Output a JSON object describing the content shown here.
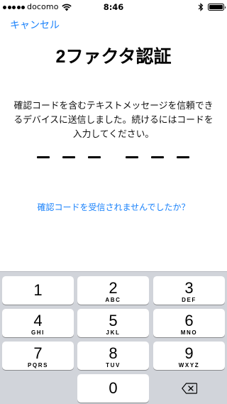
{
  "status_bar": {
    "carrier": "docomo",
    "time": "8:46",
    "icons": [
      "signal-dots-icon",
      "wifi-icon",
      "bluetooth-icon",
      "battery-icon"
    ]
  },
  "nav": {
    "cancel_label": "キャンセル"
  },
  "title": "2ファクタ認証",
  "description": "確認コードを含むテキストメッセージを信頼できるデバイスに送信しました。続けるにはコードを入力してください。",
  "code": {
    "length": 6,
    "filled": 0
  },
  "resend_link": "確認コードを受信されませんでしたか？",
  "keypad": {
    "k1": {
      "num": "1",
      "letters": ""
    },
    "k2": {
      "num": "2",
      "letters": "ABC"
    },
    "k3": {
      "num": "3",
      "letters": "DEF"
    },
    "k4": {
      "num": "4",
      "letters": "GHI"
    },
    "k5": {
      "num": "5",
      "letters": "JKL"
    },
    "k6": {
      "num": "6",
      "letters": "MNO"
    },
    "k7": {
      "num": "7",
      "letters": "PQRS"
    },
    "k8": {
      "num": "8",
      "letters": "TUV"
    },
    "k9": {
      "num": "9",
      "letters": "WXYZ"
    },
    "k0": {
      "num": "0",
      "letters": ""
    },
    "delete_icon": "backspace-icon"
  },
  "colors": {
    "accent": "#1a82fb",
    "keyboard_bg": "#d1d4da",
    "key_bg": "#ffffff"
  }
}
